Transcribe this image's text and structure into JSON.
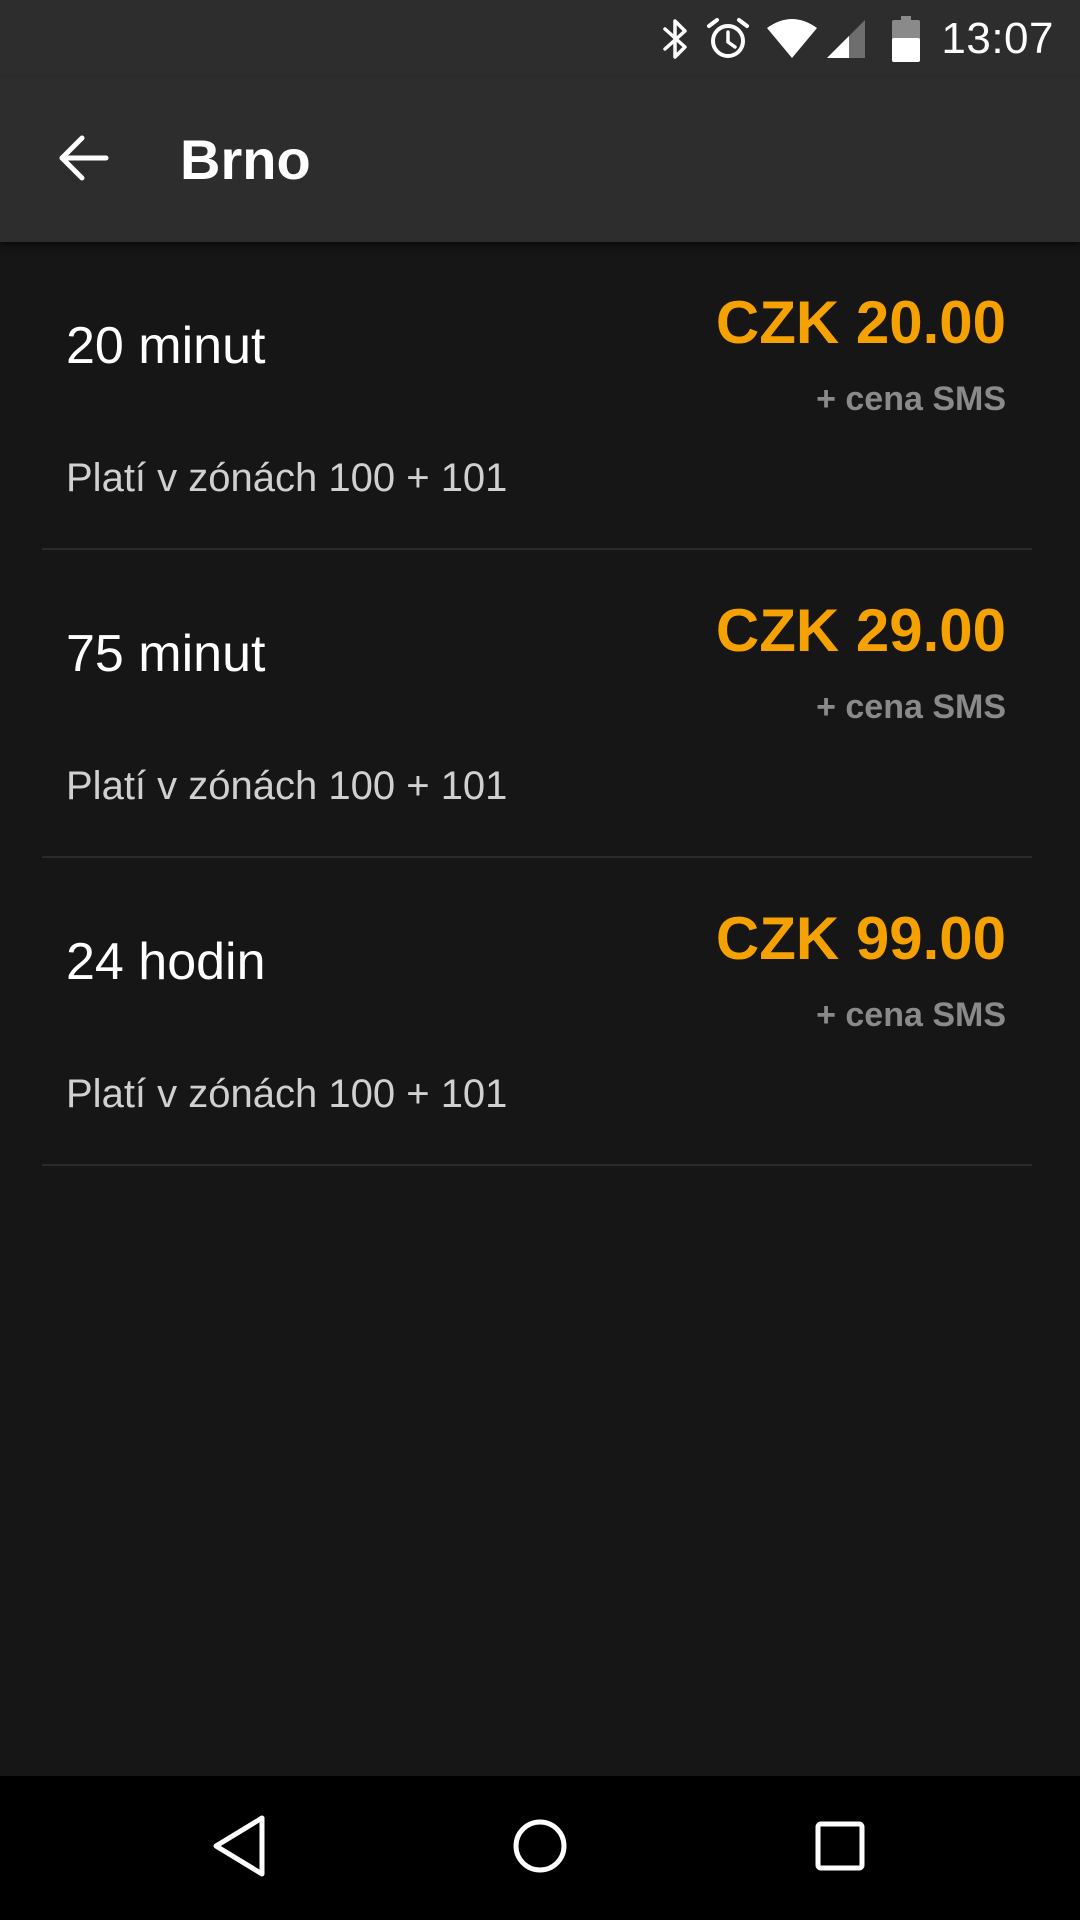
{
  "status_bar": {
    "time": "13:07",
    "icons": [
      "bluetooth-icon",
      "alarm-icon",
      "wifi-icon",
      "cell-signal-icon",
      "battery-icon"
    ]
  },
  "app_bar": {
    "title": "Brno",
    "back_icon": "arrow-back-icon"
  },
  "tickets": [
    {
      "name": "20 minut",
      "price": "CZK 20.00",
      "sms_note": "+ cena SMS",
      "zones": "Platí v zónách 100 + 101"
    },
    {
      "name": "75 minut",
      "price": "CZK 29.00",
      "sms_note": "+ cena SMS",
      "zones": "Platí v zónách 100 + 101"
    },
    {
      "name": "24 hodin",
      "price": "CZK 99.00",
      "sms_note": "+ cena SMS",
      "zones": "Platí v zónách 100 + 101"
    }
  ],
  "nav_bar": {
    "buttons": [
      "nav-back-icon",
      "nav-home-icon",
      "nav-recents-icon"
    ]
  },
  "colors": {
    "price_accent": "#f5a200",
    "app_bar_bg": "#2d2d2d",
    "page_bg": "#161616"
  }
}
